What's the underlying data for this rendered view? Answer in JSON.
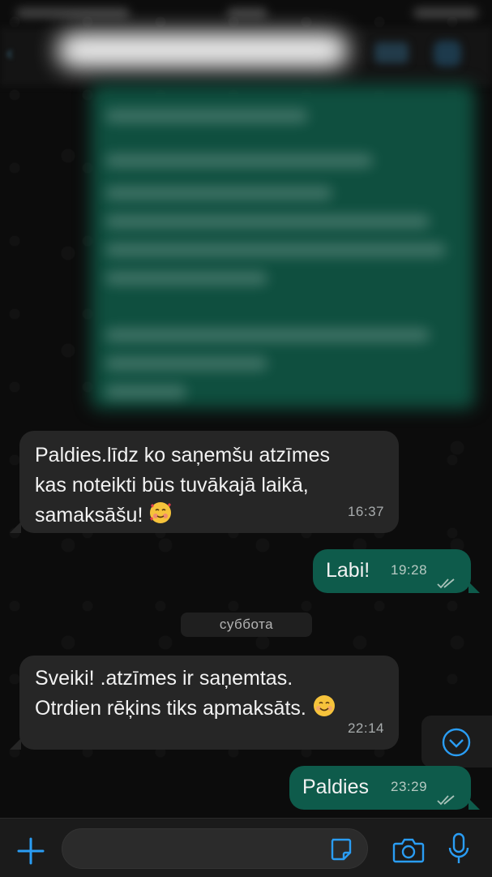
{
  "chat": {
    "date_separator": "суббота",
    "messages": [
      {
        "direction": "incoming",
        "text": "Paldies.līdz ko saņemšu atzīmes\nkas noteikti būs tuvākajā laikā,\nsamaksāšu!",
        "emoji": "smiling-face-with-hearts",
        "time": "16:37"
      },
      {
        "direction": "outgoing",
        "text": "Labi!",
        "time": "19:28",
        "status": "read"
      },
      {
        "direction": "incoming",
        "text": "Sveiki! .atzīmes ir saņemtas.\nOtrdien rēķins tiks apmaksāts.",
        "emoji": "smiling-face",
        "time": "22:14"
      },
      {
        "direction": "outgoing",
        "text": "Paldies",
        "time": "23:29",
        "status": "read"
      }
    ]
  },
  "input": {
    "placeholder": ""
  },
  "colors": {
    "accent": "#1d9bf0",
    "incoming_bubble": "#262626",
    "outgoing_bubble": "#0e5b4b",
    "background": "#0b0b0b"
  },
  "icons": {
    "attach": "plus-icon",
    "sticker": "sticker-icon",
    "camera": "camera-icon",
    "mic": "microphone-icon",
    "scroll": "chevron-down-icon",
    "read_receipt": "double-check-icon"
  }
}
